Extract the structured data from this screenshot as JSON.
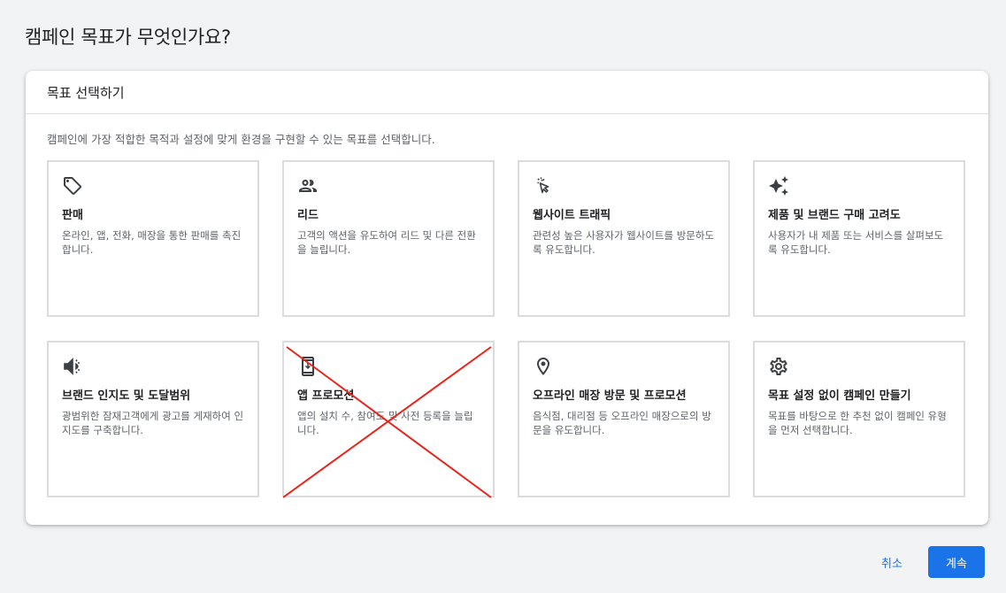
{
  "page": {
    "title": "캠페인 목표가 무엇인가요?"
  },
  "panel": {
    "header": "목표 선택하기",
    "description": "캠페인에 가장 적합한 목적과 설정에 맞게 환경을 구현할 수 있는 목표를 선택합니다."
  },
  "cards": [
    {
      "icon": "tag-icon",
      "title": "판매",
      "desc": "온라인, 앱, 전화, 매장을 통한 판매를 촉진합니다."
    },
    {
      "icon": "people-icon",
      "title": "리드",
      "desc": "고객의 액션을 유도하여 리드 및 다른 전환을 늘립니다."
    },
    {
      "icon": "cursor-click-icon",
      "title": "웹사이트 트래픽",
      "desc": "관련성 높은 사용자가 웹사이트를 방문하도록 유도합니다."
    },
    {
      "icon": "sparkle-icon",
      "title": "제품 및 브랜드 구매 고려도",
      "desc": "사용자가 내 제품 또는 서비스를 살펴보도록 유도합니다."
    },
    {
      "icon": "megaphone-icon",
      "title": "브랜드 인지도 및 도달범위",
      "desc": "광범위한 잠재고객에게 광고를 게재하여 인지도를 구축합니다."
    },
    {
      "icon": "phone-download-icon",
      "title": "앱 프로모션",
      "desc": "앱의 설치 수, 참여도 및 사전 등록을 늘립니다.",
      "crossed_out": true
    },
    {
      "icon": "location-pin-icon",
      "title": "오프라인 매장 방문 및 프로모션",
      "desc": "음식점, 대리점 등 오프라인 매장으로의 방문을 유도합니다."
    },
    {
      "icon": "gear-icon",
      "title": "목표 설정 없이 캠페인 만들기",
      "desc": "목표를 바탕으로 한 추천 없이 캠페인 유형을 먼저 선택합니다."
    }
  ],
  "footer": {
    "cancel_label": "취소",
    "continue_label": "계속"
  },
  "colors": {
    "accent": "#1a73e8",
    "cross": "#e8251a"
  }
}
